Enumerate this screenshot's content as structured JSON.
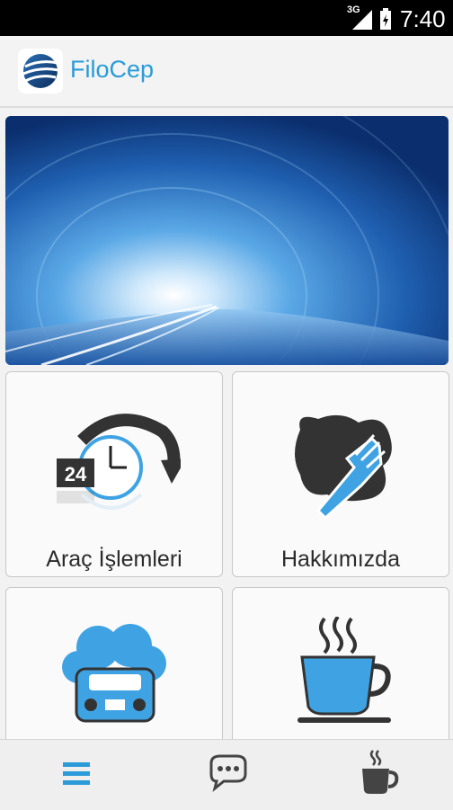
{
  "status_bar": {
    "network": "3G",
    "time": "7:40"
  },
  "app": {
    "title": "FiloCep"
  },
  "tiles": [
    {
      "label": "Araç İşlemleri",
      "icon": "clock-24-arrow-icon"
    },
    {
      "label": "Hakkımızda",
      "icon": "hand-cleaning-icon"
    },
    {
      "label": "",
      "icon": "car-balloons-icon"
    },
    {
      "label": "",
      "icon": "coffee-cup-icon"
    }
  ],
  "clock_badge": "24",
  "bottom_nav": [
    {
      "icon": "menu-icon"
    },
    {
      "icon": "chat-icon"
    },
    {
      "icon": "coffee-icon"
    }
  ],
  "colors": {
    "accent": "#2a9bd8",
    "icon_blue": "#3fa3e3",
    "dark": "#333333"
  }
}
